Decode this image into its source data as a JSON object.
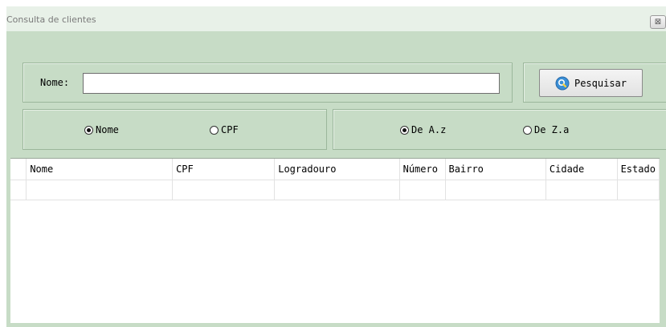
{
  "window": {
    "title": "Consulta de clientes",
    "close_glyph": "⊠"
  },
  "search": {
    "label": "Nome:",
    "value": "",
    "button_label": "Pesquisar"
  },
  "filter": {
    "options": [
      {
        "label": "Nome",
        "checked": true
      },
      {
        "label": "CPF",
        "checked": false
      }
    ]
  },
  "sort": {
    "options": [
      {
        "label": "De A.z",
        "checked": true
      },
      {
        "label": "De Z.a",
        "checked": false
      }
    ]
  },
  "table": {
    "columns": [
      "Nome",
      "CPF",
      "Logradouro",
      "Número",
      "Bairro",
      "Cidade",
      "Estado"
    ],
    "rows": [
      [
        "",
        "",
        "",
        "",
        "",
        "",
        ""
      ]
    ]
  },
  "colors": {
    "panel_bg": "#c7dcc6",
    "title_bg": "#e8f1e8",
    "search_icon": "#3a8fd6"
  }
}
